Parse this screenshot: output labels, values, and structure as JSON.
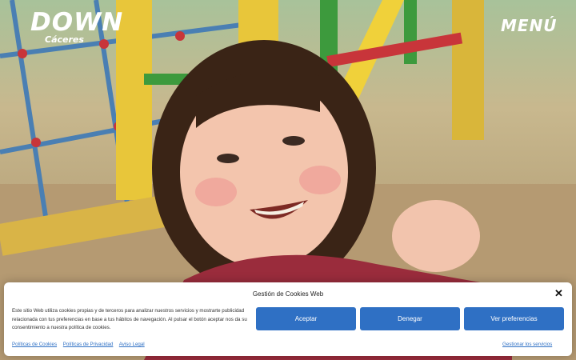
{
  "header": {
    "logo_main": "DOWN",
    "logo_sub": "Cáceres",
    "menu_label": "MENÚ"
  },
  "colors": {
    "accent_button": "#2f70c4",
    "banner_background": "#ffffff",
    "playground_yellow": "#e8c63a",
    "playground_green": "#3d9a3d",
    "playground_red": "#c8353a",
    "rope_blue": "#4a7fb3"
  },
  "cookie_banner": {
    "title": "Gestión de Cookies Web",
    "text": "Este sitio Web utiliza cookies propias y de terceros para analizar nuestros servicios y mostrarte publicidad relacionada con tus preferencias en base a tus hábitos de navegación. Al pulsar el botón aceptar nos da su consentimiento a nuestra política de cookies.",
    "accept_label": "Aceptar",
    "deny_label": "Denegar",
    "preferences_label": "Ver preferencias",
    "links": [
      "Políticas de Cookies",
      "Políticas de Privacidad",
      "Aviso Legal"
    ],
    "manage_label": "Gestionar los servicios",
    "close_icon": "close-icon"
  }
}
